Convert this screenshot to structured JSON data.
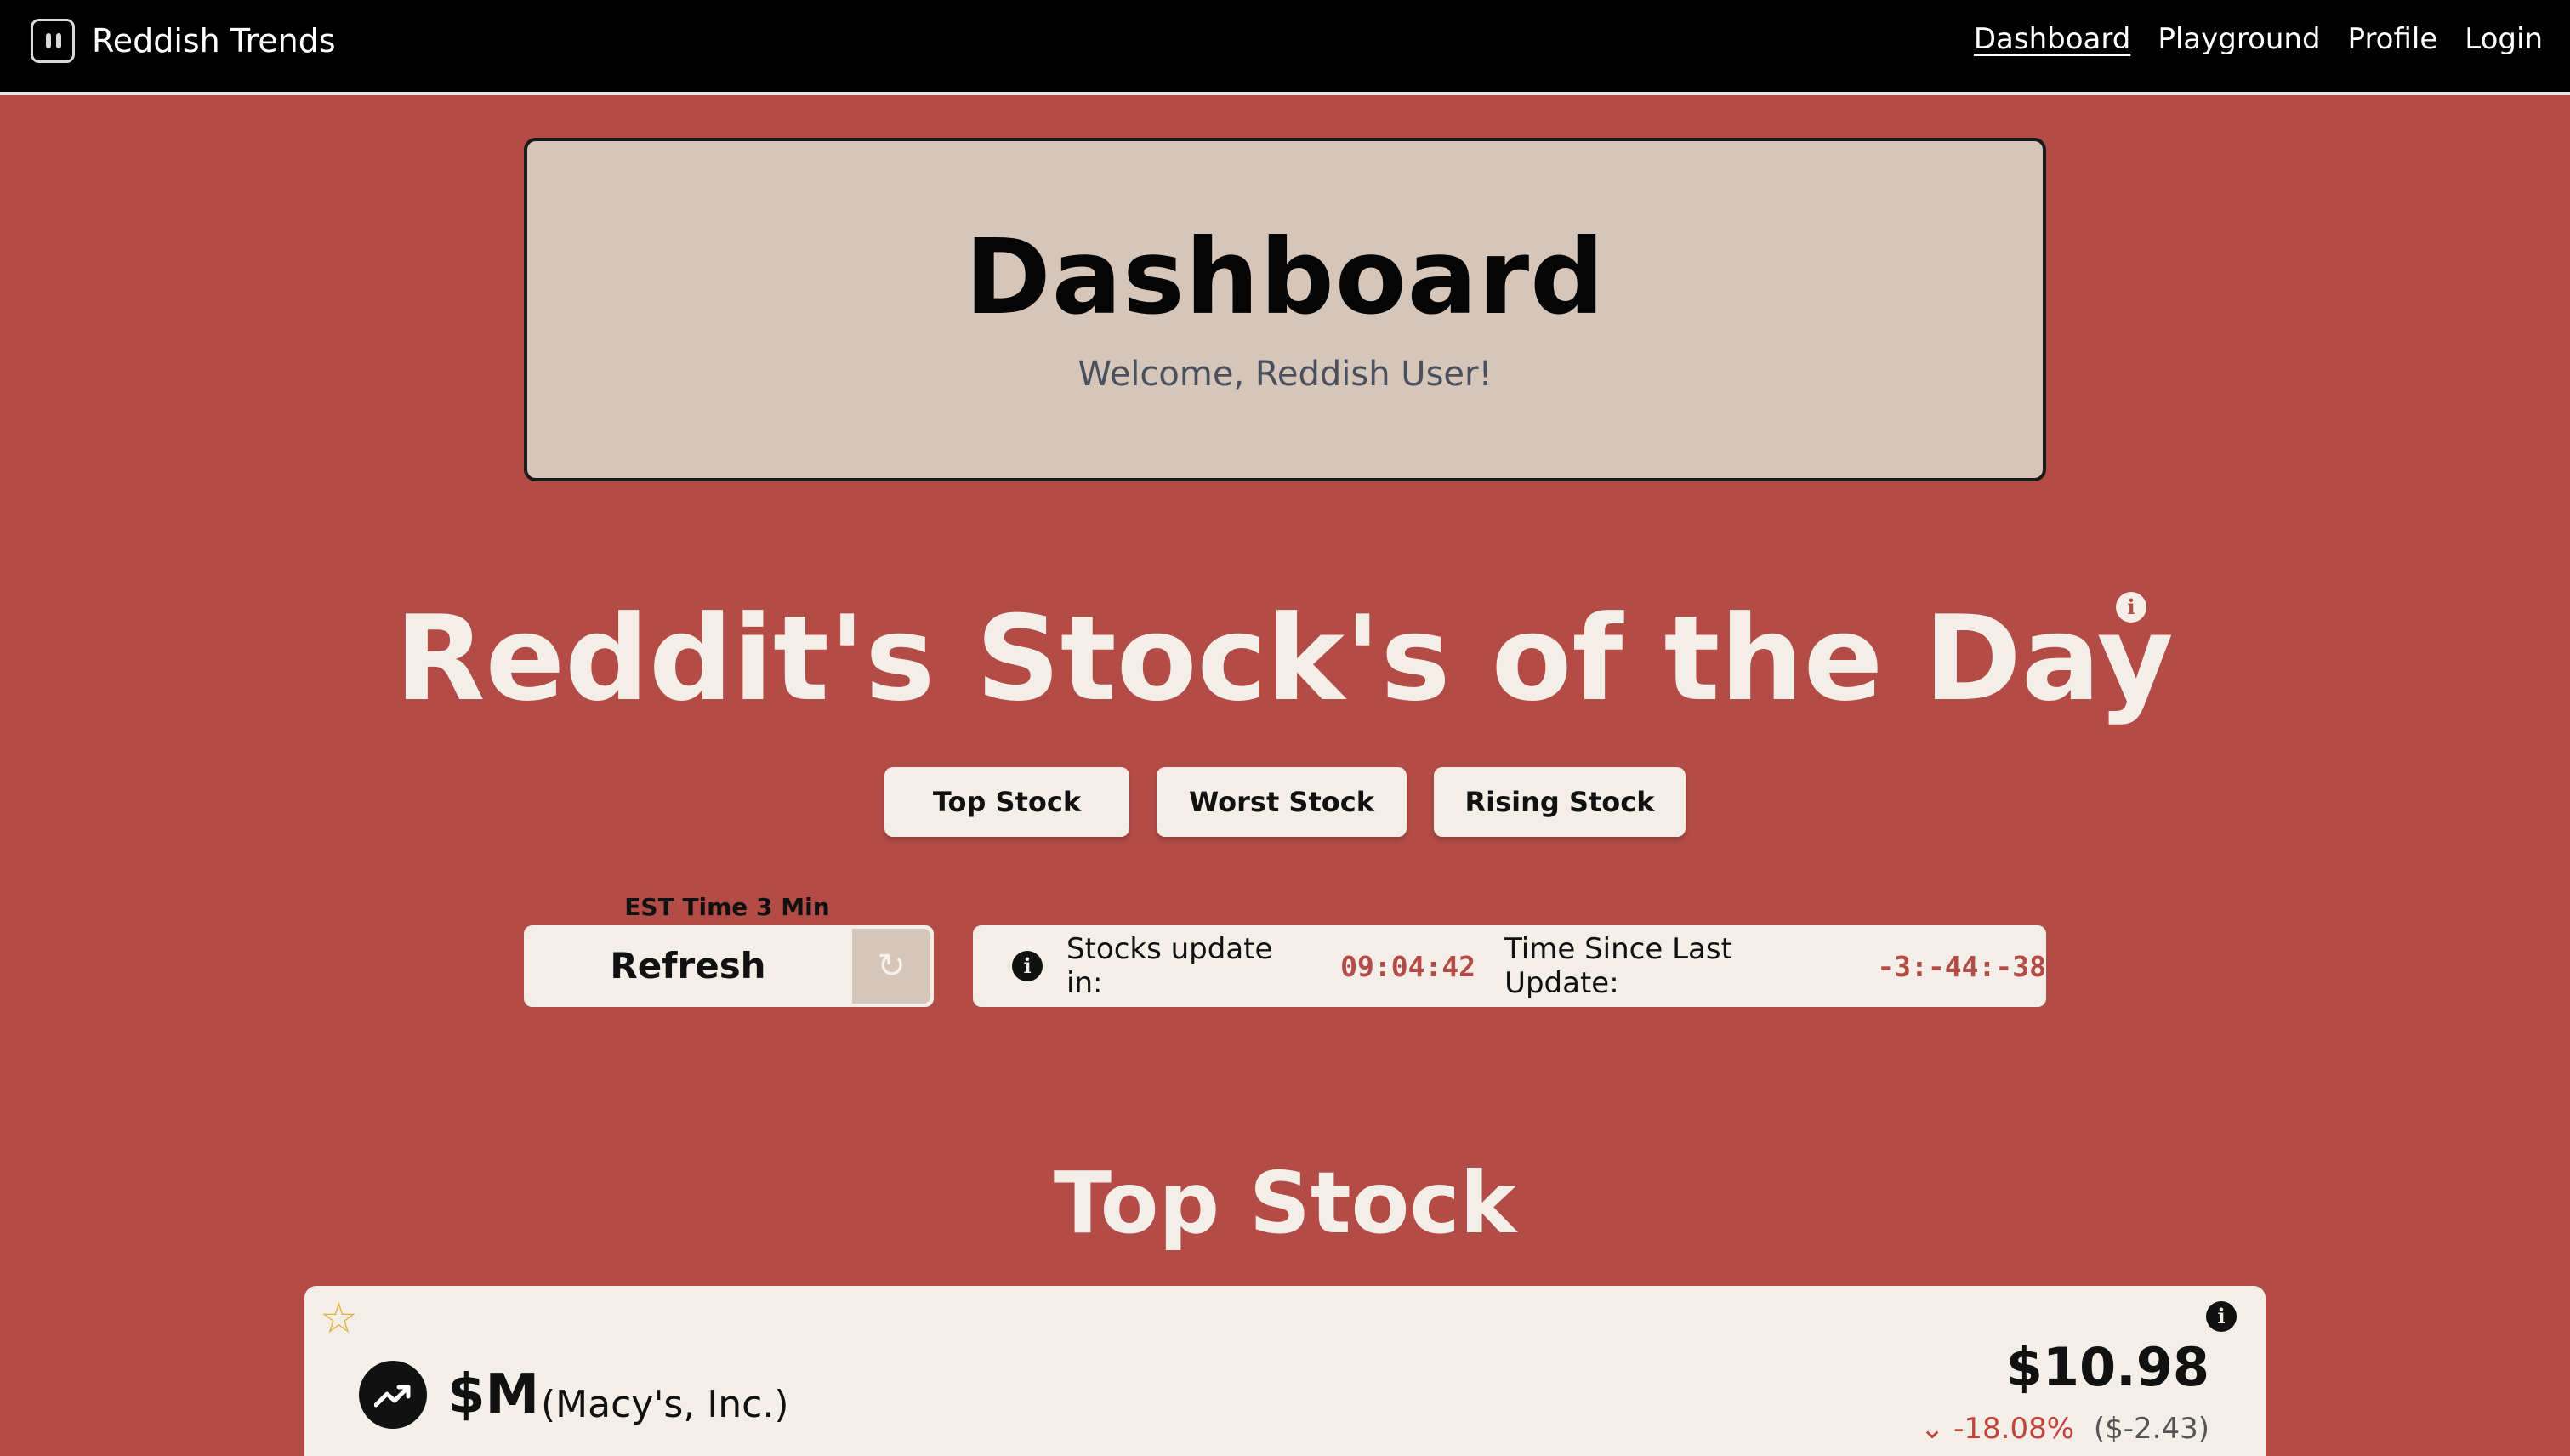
{
  "nav": {
    "brand": "Reddish Trends",
    "links": [
      "Dashboard",
      "Playground",
      "Profile",
      "Login"
    ],
    "active": "Dashboard"
  },
  "header": {
    "title": "Dashboard",
    "subtitle": "Welcome, Reddish User!"
  },
  "main": {
    "heading": "Reddit's Stock's of the Day",
    "buttons": [
      "Top Stock",
      "Worst Stock",
      "Rising Stock"
    ],
    "est_label": "EST Time 3 Min",
    "refresh_label": "Refresh",
    "update": {
      "label": "Stocks update in:",
      "countdown": "09:04:42",
      "since_label": "Time Since Last Update:",
      "since_value": "-3:-44:-38"
    },
    "section_title": "Top Stock"
  },
  "stock": {
    "ticker": "$M",
    "company": "(Macy's, Inc.)",
    "price": "$10.98",
    "change_pct": "-18.08%",
    "change_amt": "($-2.43)"
  },
  "colors": {
    "background": "#b34c46",
    "card": "#f3eee7",
    "header_card": "#d6c5b9",
    "negative": "#c2433a",
    "star": "#e0b43c"
  },
  "icons": {
    "brand": "app-logo-icon",
    "info": "info-icon",
    "refresh": "refresh-icon",
    "star": "star-outline-icon",
    "trend": "trending-up-icon",
    "change": "chevron-down-icon"
  }
}
